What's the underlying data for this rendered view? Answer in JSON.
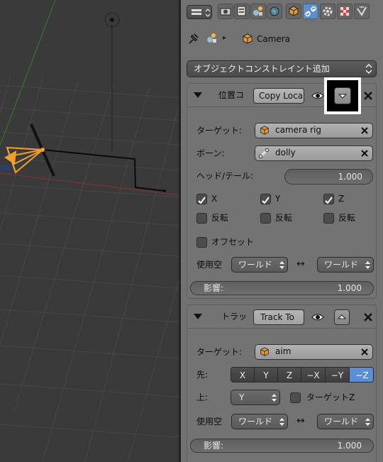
{
  "viewport": {
    "label": "3d-viewport"
  },
  "header": {
    "context_icons": [
      "render-icon",
      "render-layers-icon",
      "scene-icon",
      "world-icon",
      "object-icon",
      "constraints-icon",
      "modifiers-icon",
      "data-icon",
      "material-icon",
      "texture-icon"
    ],
    "breadcrumb_object": "Camera"
  },
  "add_constraint": {
    "label": "オブジェクトコンストレイント追加"
  },
  "copy_location": {
    "short_title": "位置コ",
    "name_value": "Copy Loca",
    "target_label": "ターゲット:",
    "target_value": "camera rig",
    "bone_label": "ボーン:",
    "bone_value": "dolly",
    "headtail_label": "ヘッド/テール:",
    "headtail_value": "1.000",
    "axes": [
      {
        "label": "X",
        "checked": true
      },
      {
        "label": "Y",
        "checked": true
      },
      {
        "label": "Z",
        "checked": true
      }
    ],
    "invert_label": "反転",
    "offset_label": "オフセット",
    "space_label": "使用空",
    "owner_space": "ワールド",
    "target_space": "ワールド",
    "swap_icon": "↔",
    "influence_label": "影響:",
    "influence_value": "1.000"
  },
  "track_to": {
    "short_title": "トラッ",
    "name_value": "Track To",
    "target_label": "ターゲット:",
    "target_value": "aim",
    "to_label": "先:",
    "to_axes": [
      {
        "label": "X",
        "selected": false
      },
      {
        "label": "Y",
        "selected": false
      },
      {
        "label": "Z",
        "selected": false
      },
      {
        "label": "−X",
        "selected": false
      },
      {
        "label": "−Y",
        "selected": false
      },
      {
        "label": "−Z",
        "selected": true
      }
    ],
    "up_label": "上:",
    "up_value": "Y",
    "target_z_label": "ターゲットZ",
    "space_label": "使用空",
    "owner_space": "ワールド",
    "target_space": "ワールド",
    "swap_icon": "↔",
    "influence_label": "影響:",
    "influence_value": "1.000"
  },
  "colors": {
    "accent": "#5a8fd6",
    "selected_object": "#f0a030"
  }
}
